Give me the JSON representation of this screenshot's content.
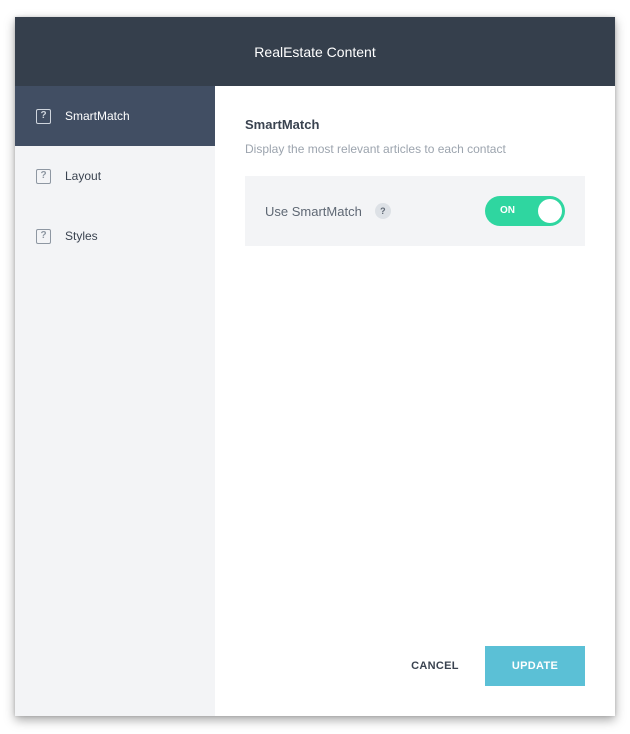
{
  "header": {
    "title": "RealEstate Content"
  },
  "sidebar": {
    "items": [
      {
        "label": "SmartMatch",
        "icon": "help-square-icon",
        "active": true
      },
      {
        "label": "Layout",
        "icon": "help-square-icon",
        "active": false
      },
      {
        "label": "Styles",
        "icon": "help-square-icon",
        "active": false
      }
    ],
    "icon_glyph": "?"
  },
  "main": {
    "section_title": "SmartMatch",
    "section_description": "Display the most relevant articles to each contact",
    "setting": {
      "label": "Use SmartMatch",
      "help_glyph": "?",
      "toggle_text": "ON",
      "toggle_on": true
    }
  },
  "footer": {
    "cancel_label": "CANCEL",
    "update_label": "UPDATE"
  },
  "colors": {
    "header_bg": "#353f4c",
    "sidebar_active_bg": "#414e63",
    "sidebar_bg": "#f3f4f6",
    "toggle_on": "#2fd6a0",
    "update_button": "#5bc0d6"
  }
}
